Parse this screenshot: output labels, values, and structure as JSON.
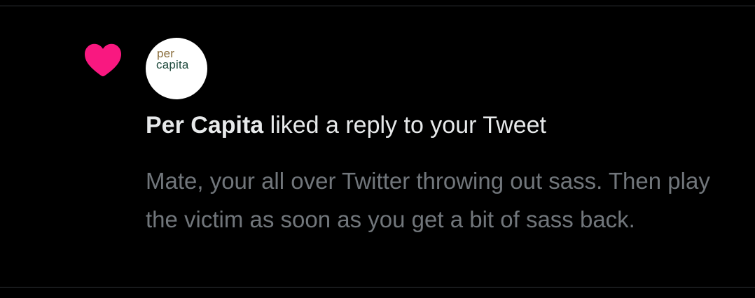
{
  "notification": {
    "type_icon": "heart-icon",
    "accent_color": "#f91880",
    "avatar": {
      "logo_line1": "per",
      "logo_line2": "capita"
    },
    "user_name": "Per Capita",
    "action_text": " liked a reply to your Tweet",
    "reply_text": "Mate, your all over Twitter throwing out sass. Then play the victim as soon as you get a bit of sass back."
  }
}
